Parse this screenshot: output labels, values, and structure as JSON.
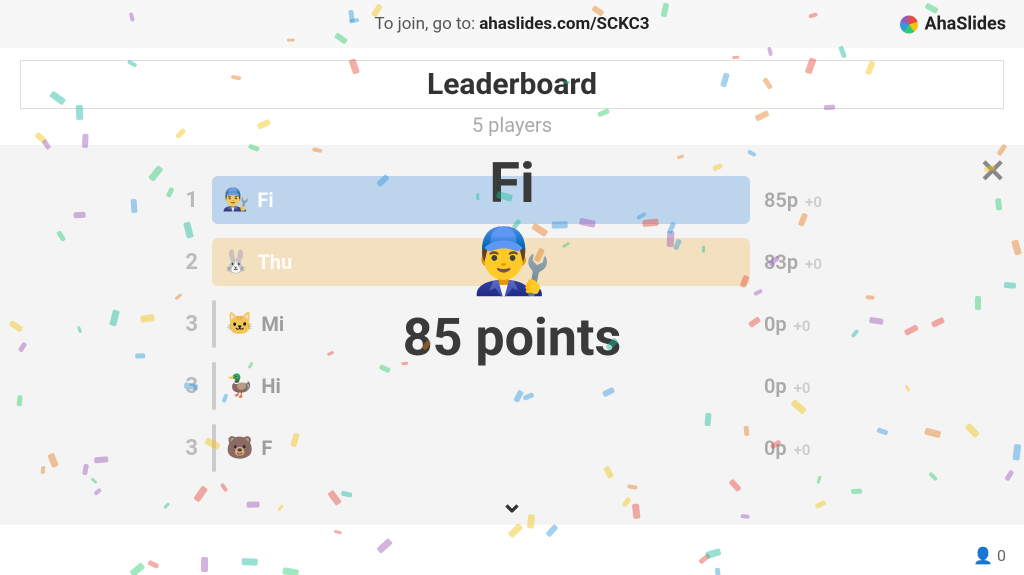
{
  "header": {
    "join_prefix": "To join, go to:",
    "join_url": "ahaslides.com/SCKC3",
    "brand": "AhaSlides"
  },
  "title": "Leaderboard",
  "subtitle": "5 players",
  "close_label": "✕",
  "rows": [
    {
      "rank": "1",
      "avatar": "👨‍🔧",
      "name": "Fi",
      "score": "85p",
      "delta": "+0",
      "fill": "r1 full"
    },
    {
      "rank": "2",
      "avatar": "🐰",
      "name": "Thu",
      "score": "83p",
      "delta": "+0",
      "fill": "r2 full"
    },
    {
      "rank": "3",
      "avatar": "🐱",
      "name": "Mi",
      "score": "0p",
      "delta": "+0",
      "fill": "none"
    },
    {
      "rank": "3",
      "avatar": "🦆",
      "name": "Hi",
      "score": "0p",
      "delta": "+0",
      "fill": "none"
    },
    {
      "rank": "3",
      "avatar": "🐻",
      "name": "F",
      "score": "0p",
      "delta": "+0",
      "fill": "none"
    }
  ],
  "spotlight": {
    "name": "Fi",
    "avatar": "👨‍🔧",
    "points": "85 points"
  },
  "chevron": "⌄",
  "footer": {
    "participants_icon": "👤",
    "participants_count": "0"
  },
  "confetti_colors": [
    "#e74c3c",
    "#f1c40f",
    "#2ecc71",
    "#3498db",
    "#9b59b6",
    "#1abc9c",
    "#e67e22"
  ]
}
